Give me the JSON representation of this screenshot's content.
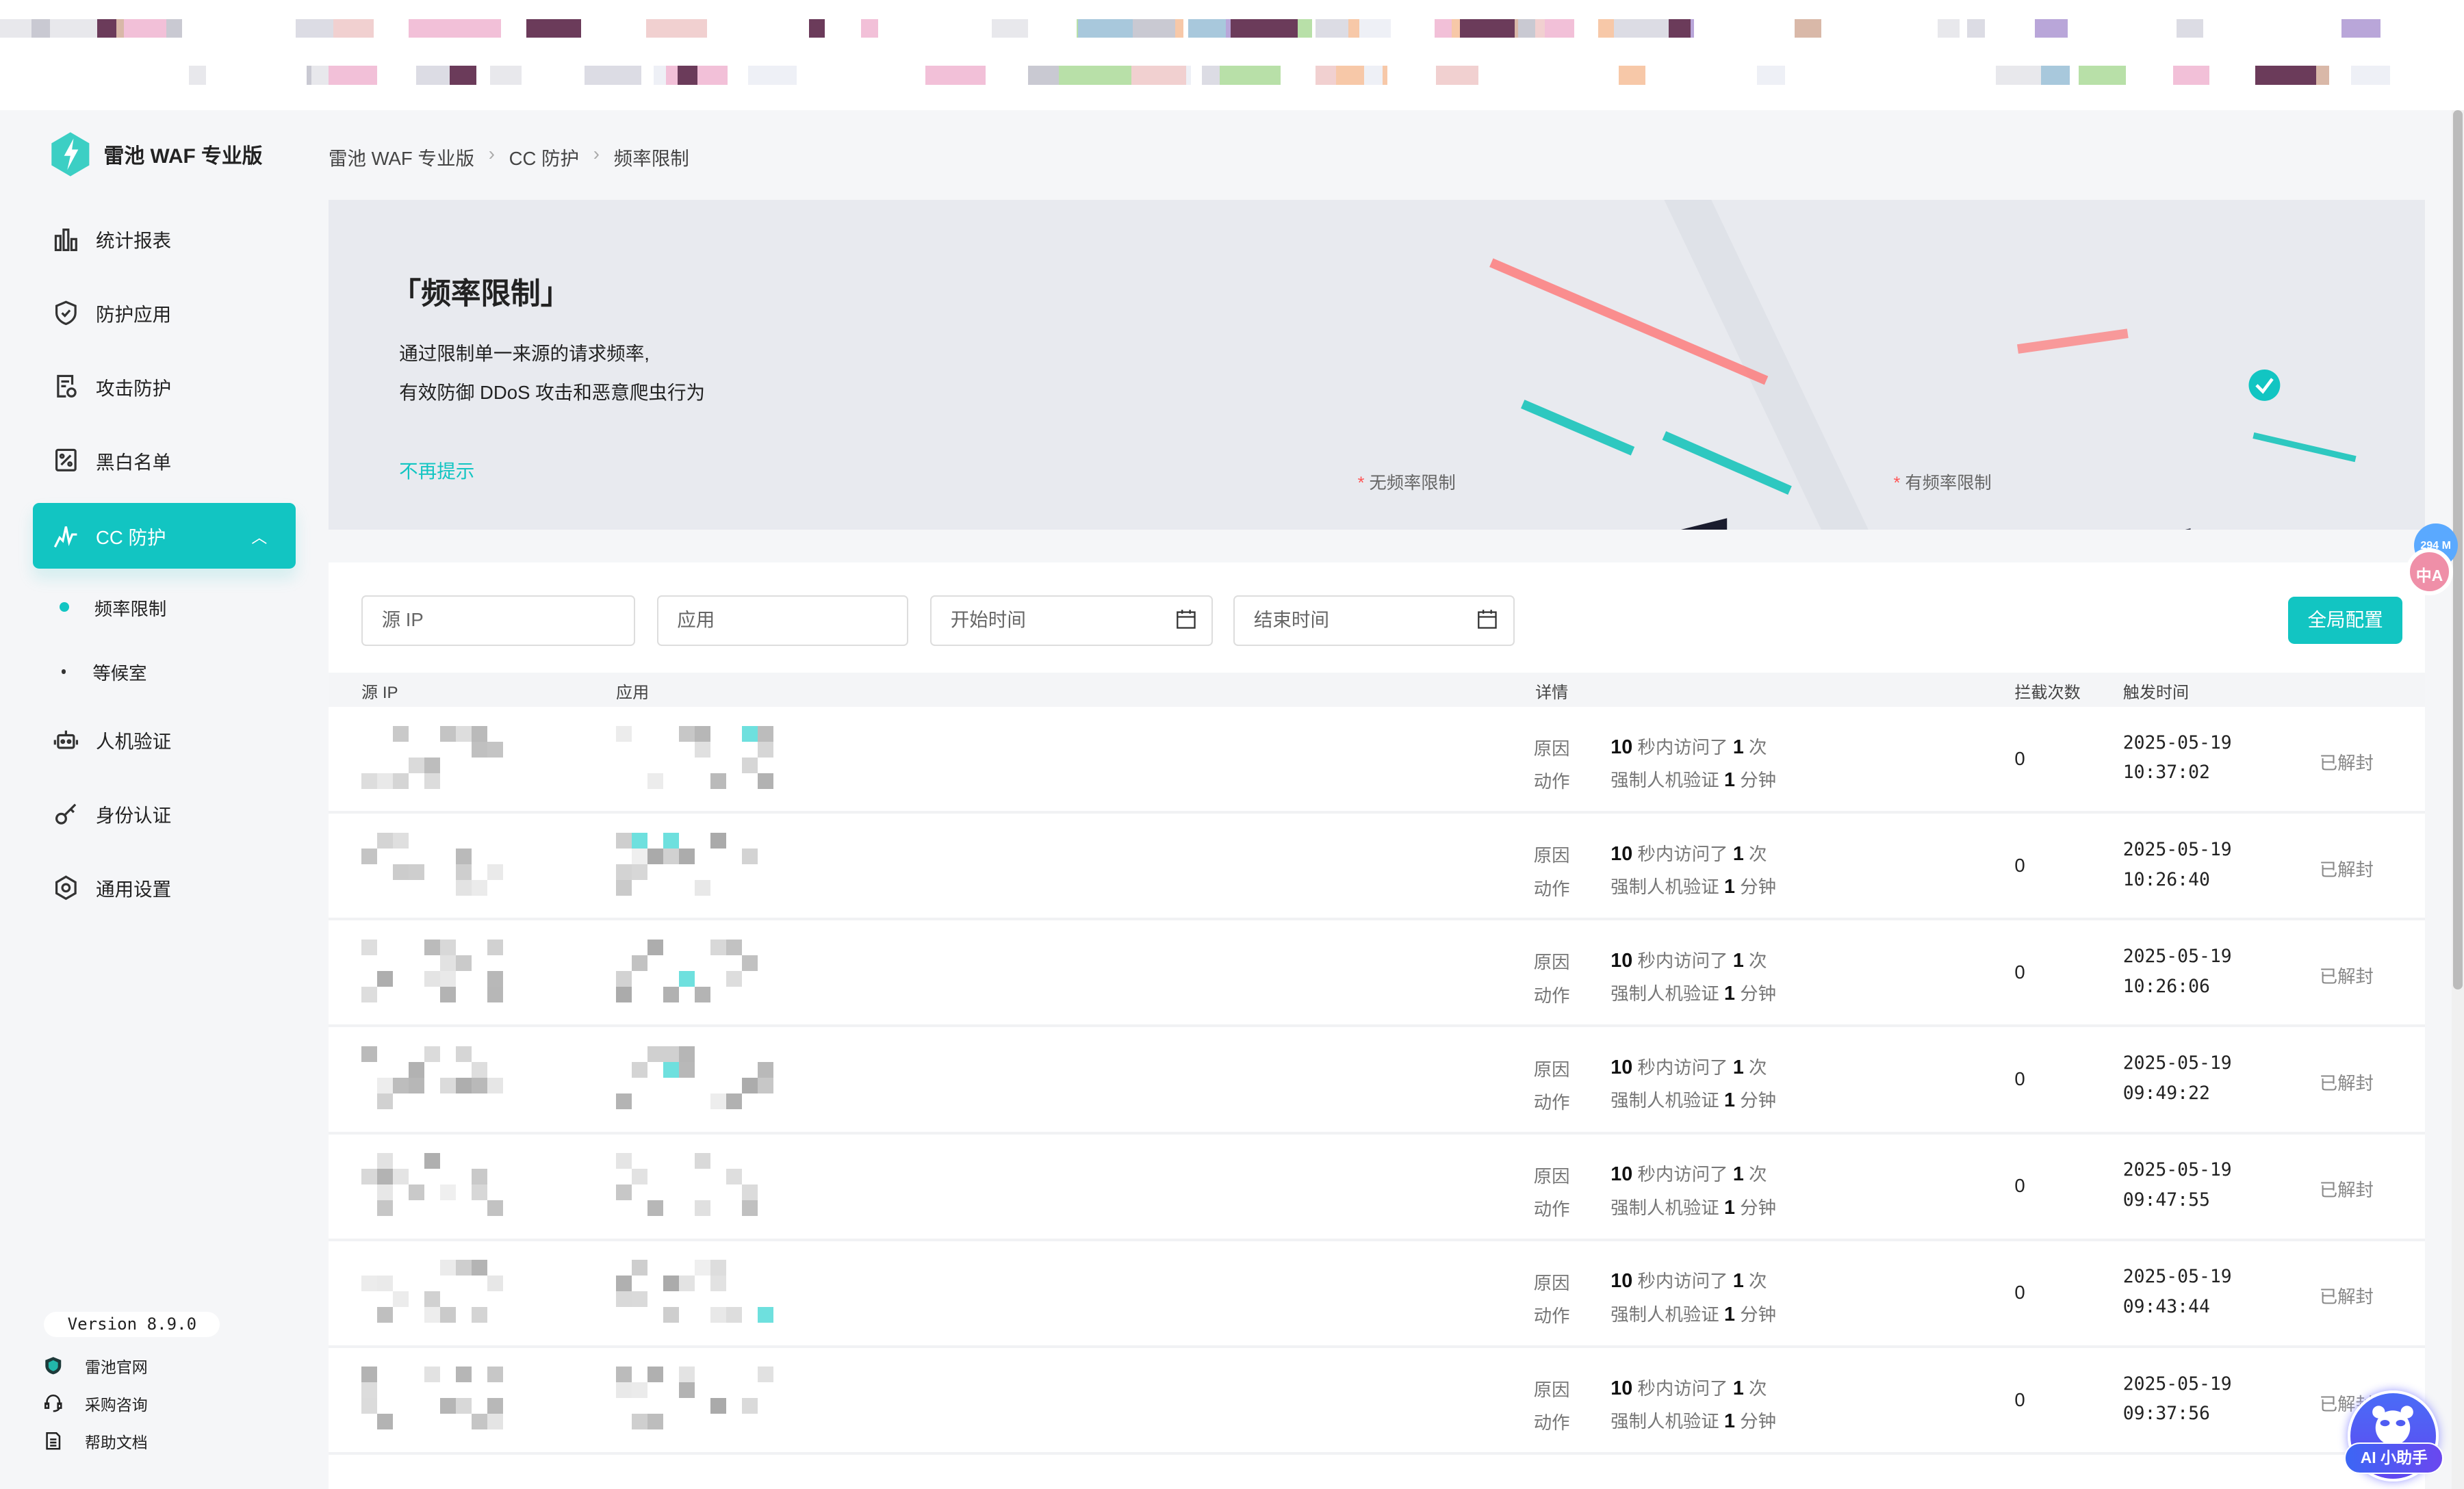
{
  "app": {
    "name": "雷池 WAF 专业版"
  },
  "breadcrumb": [
    "雷池 WAF 专业版",
    "CC 防护",
    "频率限制"
  ],
  "sidebar": {
    "items": [
      {
        "label": "统计报表",
        "icon": "bar-chart-icon"
      },
      {
        "label": "防护应用",
        "icon": "shield-check-icon"
      },
      {
        "label": "攻击防护",
        "icon": "document-refresh-icon"
      },
      {
        "label": "黑白名单",
        "icon": "percent-list-icon"
      },
      {
        "label": "CC 防护",
        "icon": "pulse-icon",
        "active": true,
        "expanded": true
      },
      {
        "label": "人机验证",
        "icon": "robot-icon"
      },
      {
        "label": "身份认证",
        "icon": "key-icon"
      },
      {
        "label": "通用设置",
        "icon": "gear-icon"
      }
    ],
    "subitems": [
      {
        "label": "频率限制",
        "active": true
      },
      {
        "label": "等候室"
      }
    ],
    "version": "Version 8.9.0",
    "links": [
      {
        "label": "雷池官网",
        "icon": "safeline-shield-icon"
      },
      {
        "label": "采购咨询",
        "icon": "headset-icon"
      },
      {
        "label": "帮助文档",
        "icon": "document-icon"
      }
    ]
  },
  "banner": {
    "title": "「频率限制」",
    "desc1": "通过限制单一来源的请求频率,",
    "desc2": "有效防御 DDoS 攻击和恶意爬虫行为",
    "dismiss": "不再提示",
    "caption_without": "无频率限制",
    "caption_with": "有频率限制"
  },
  "filters": {
    "source_ip": "源 IP",
    "app": "应用",
    "start_time": "开始时间",
    "end_time": "结束时间",
    "global_config": "全局配置"
  },
  "table": {
    "headers": {
      "source_ip": "源 IP",
      "app": "应用",
      "detail": "详情",
      "count": "拦截次数",
      "time": "触发时间"
    },
    "rows": [
      {
        "reason_label": "原因",
        "reason_n": "10",
        "reason_mid": "秒内访问了",
        "reason_m": "1",
        "reason_end": "次",
        "action_label": "动作",
        "action_text": "强制人机验证",
        "action_n": "1",
        "action_unit": "分钟",
        "count": "0",
        "date": "2025-05-19",
        "time": "10:37:02",
        "status": "已解封"
      },
      {
        "reason_label": "原因",
        "reason_n": "10",
        "reason_mid": "秒内访问了",
        "reason_m": "1",
        "reason_end": "次",
        "action_label": "动作",
        "action_text": "强制人机验证",
        "action_n": "1",
        "action_unit": "分钟",
        "count": "0",
        "date": "2025-05-19",
        "time": "10:26:40",
        "status": "已解封"
      },
      {
        "reason_label": "原因",
        "reason_n": "10",
        "reason_mid": "秒内访问了",
        "reason_m": "1",
        "reason_end": "次",
        "action_label": "动作",
        "action_text": "强制人机验证",
        "action_n": "1",
        "action_unit": "分钟",
        "count": "0",
        "date": "2025-05-19",
        "time": "10:26:06",
        "status": "已解封"
      },
      {
        "reason_label": "原因",
        "reason_n": "10",
        "reason_mid": "秒内访问了",
        "reason_m": "1",
        "reason_end": "次",
        "action_label": "动作",
        "action_text": "强制人机验证",
        "action_n": "1",
        "action_unit": "分钟",
        "count": "0",
        "date": "2025-05-19",
        "time": "09:49:22",
        "status": "已解封"
      },
      {
        "reason_label": "原因",
        "reason_n": "10",
        "reason_mid": "秒内访问了",
        "reason_m": "1",
        "reason_end": "次",
        "action_label": "动作",
        "action_text": "强制人机验证",
        "action_n": "1",
        "action_unit": "分钟",
        "count": "0",
        "date": "2025-05-19",
        "time": "09:47:55",
        "status": "已解封"
      },
      {
        "reason_label": "原因",
        "reason_n": "10",
        "reason_mid": "秒内访问了",
        "reason_m": "1",
        "reason_end": "次",
        "action_label": "动作",
        "action_text": "强制人机验证",
        "action_n": "1",
        "action_unit": "分钟",
        "count": "0",
        "date": "2025-05-19",
        "time": "09:43:44",
        "status": "已解封"
      },
      {
        "reason_label": "原因",
        "reason_n": "10",
        "reason_mid": "秒内访问了",
        "reason_m": "1",
        "reason_end": "次",
        "action_label": "动作",
        "action_text": "强制人机验证",
        "action_n": "1",
        "action_unit": "分钟",
        "count": "0",
        "date": "2025-05-19",
        "time": "09:37:56",
        "status": "已解封"
      }
    ]
  },
  "floating": {
    "memory": "294 M",
    "translate": "中A",
    "ai_assistant": "AI 小助手"
  },
  "colors": {
    "accent": "#12c5c2",
    "banner_bg": "#e8eaef",
    "ai": "#4a6cf7"
  }
}
